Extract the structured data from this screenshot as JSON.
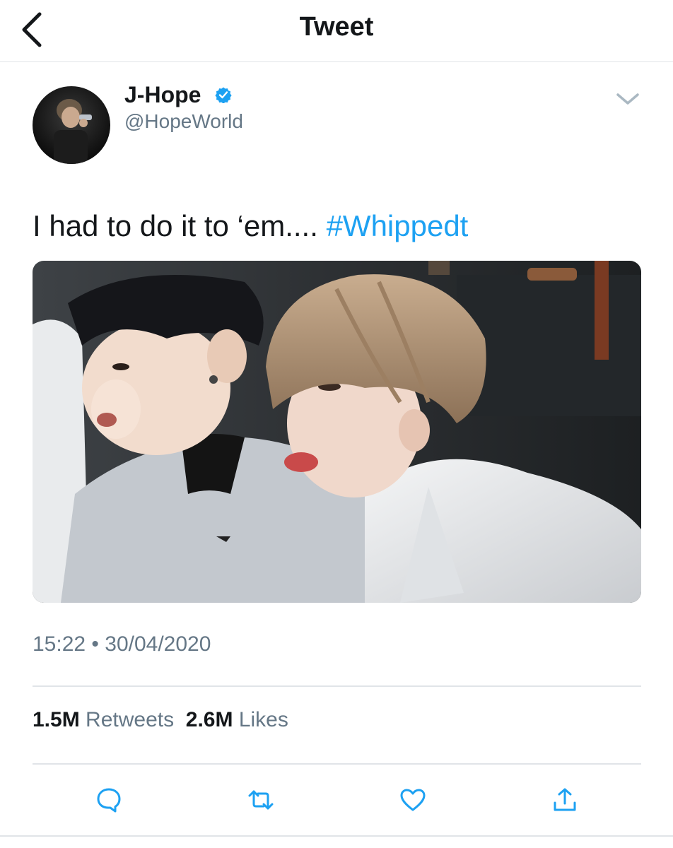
{
  "header": {
    "title": "Tweet",
    "back_icon": "chevron-left-icon"
  },
  "author": {
    "name": "J-Hope",
    "handle": "@HopeWorld",
    "verified": true,
    "verified_color": "#1da1f2"
  },
  "tweet": {
    "text": "I had to do it to ‘em.... ",
    "hashtag": "#Whippedt",
    "hashtag_color": "#1da1f2",
    "timestamp": "15:22",
    "separator": " • ",
    "date": "30/04/2020"
  },
  "stats": {
    "retweets_count": "1.5M",
    "retweets_label": "Retweets",
    "likes_count": "2.6M",
    "likes_label": "Likes"
  },
  "actions": {
    "reply_icon": "speech-bubble-icon",
    "retweet_icon": "retweet-icon",
    "like_icon": "heart-icon",
    "share_icon": "share-icon",
    "icon_color": "#1da1f2"
  }
}
